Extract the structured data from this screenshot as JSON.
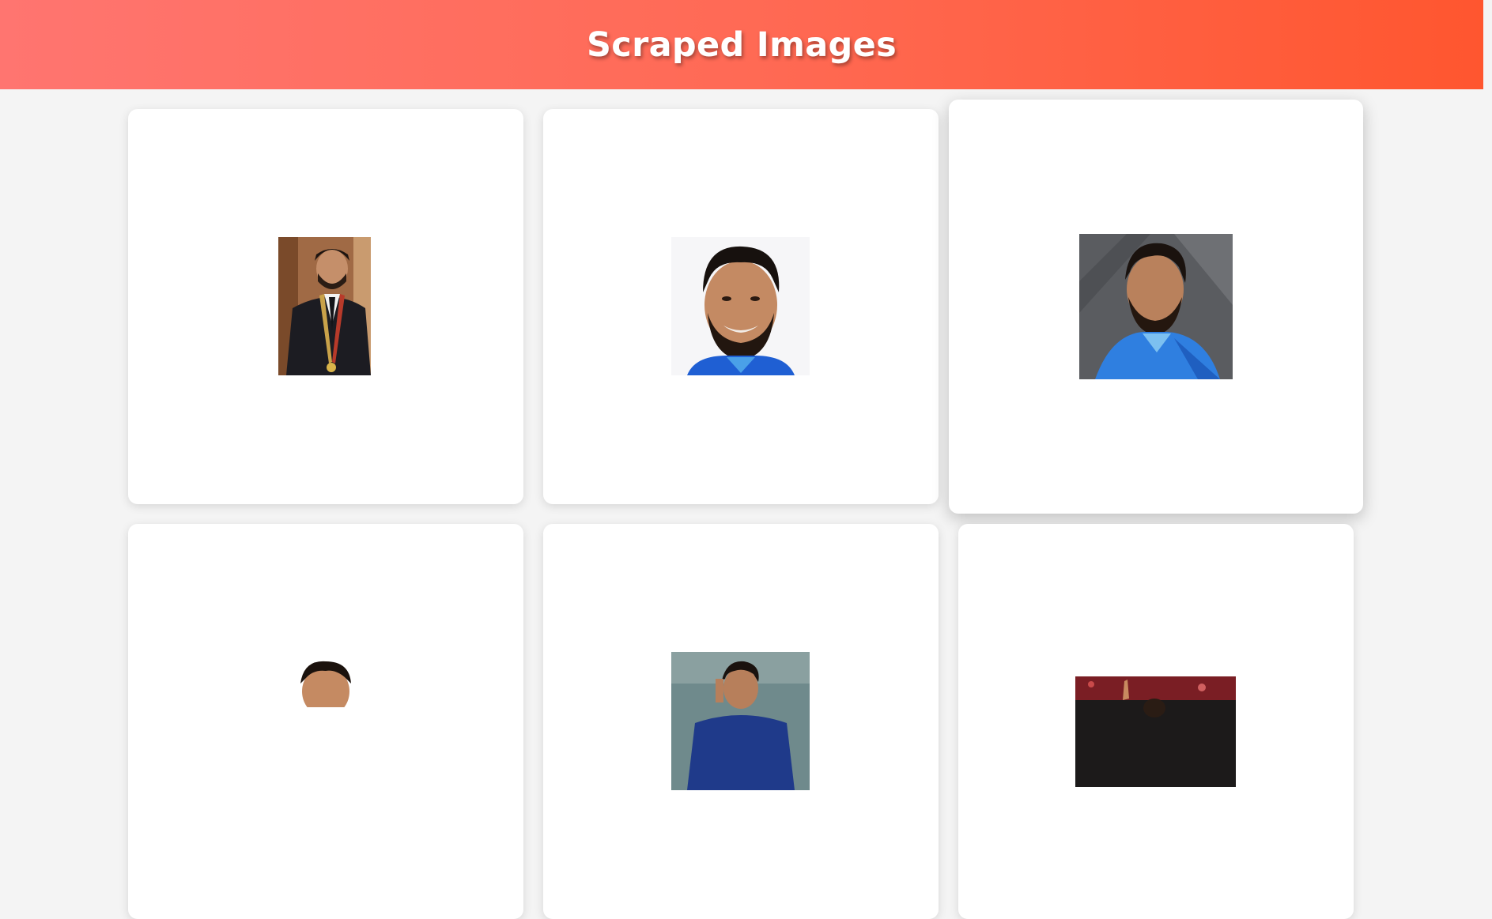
{
  "page": {
    "title": "Scraped Images"
  },
  "colors": {
    "header_start": "#ff7570",
    "header_end": "#ff562f",
    "background": "#f4f4f4",
    "card": "#ffffff"
  },
  "gallery": {
    "images": [
      {
        "name": "portrait-suit-medal",
        "icon": "person-photo"
      },
      {
        "name": "portrait-blue-jersey-white-bg",
        "icon": "person-photo"
      },
      {
        "name": "portrait-blue-jersey-grey-bg",
        "icon": "person-photo"
      },
      {
        "name": "portrait-partial-4",
        "icon": "person-photo"
      },
      {
        "name": "portrait-partial-5",
        "icon": "person-photo"
      },
      {
        "name": "portrait-partial-6",
        "icon": "person-photo"
      }
    ]
  }
}
